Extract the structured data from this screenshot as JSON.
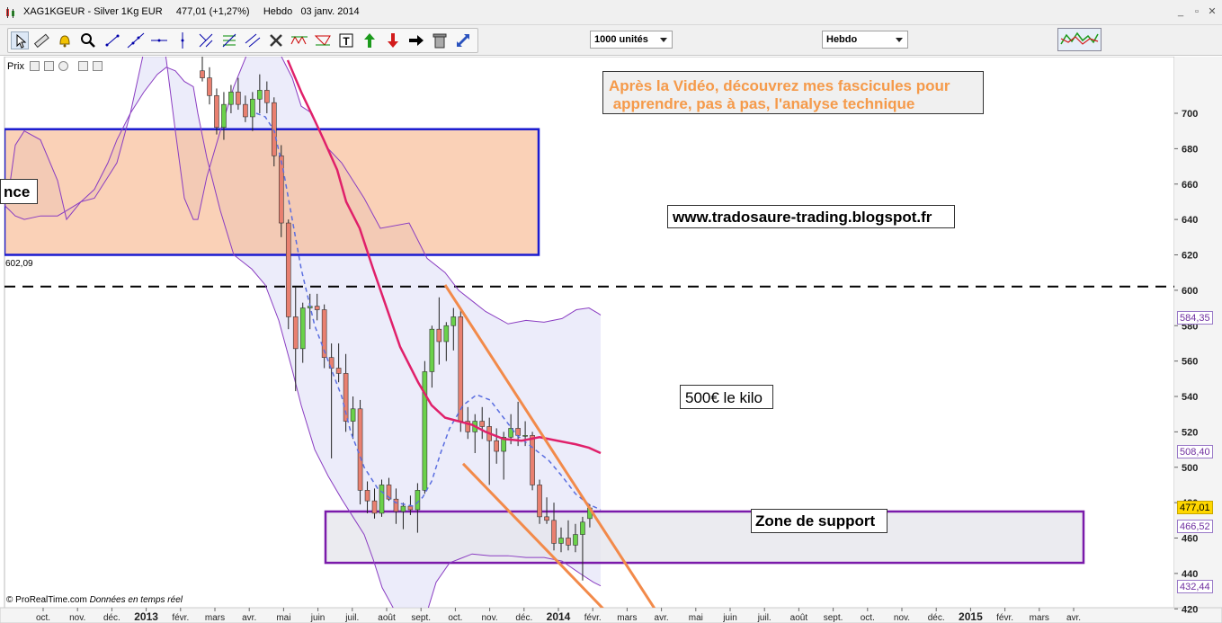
{
  "window": {
    "title": "XAG1KGEUR - Silver 1Kg EUR     477,01 (+1,27%)     Hebdo   03 janv. 2014",
    "minimize": "_",
    "restore": "▫",
    "close": "✕"
  },
  "toolbar": {
    "icons": [
      "cursor-icon",
      "ruler-icon",
      "alarm-icon",
      "zoom-icon",
      "segment-icon",
      "line-icon",
      "horizontal-line-icon",
      "vertical-line-icon",
      "crosshair-icon",
      "fibonacci-icon",
      "channel-icon",
      "tools-icon",
      "pattern-icon",
      "triangle-icon",
      "text-icon",
      "buy-arrow-icon",
      "sell-arrow-icon",
      "right-arrow-icon",
      "trash-icon",
      "expand-icon"
    ],
    "quantity": "1000 unités",
    "period": "Hebdo"
  },
  "chart_header": {
    "label": "Prix"
  },
  "notes": {
    "promo": "Après la Vidéo, découvrez mes fascicules pour\n apprendre, pas à pas, l'analyse technique",
    "blog": "www.tradosaure-trading.blogspot.fr",
    "kilo": "500€ le kilo",
    "support": "Zone de support",
    "resistance": "nce"
  },
  "reference_level": "602,09",
  "price_labels": [
    {
      "text": "584,35",
      "value": 584.35,
      "color": "#7030a0"
    },
    {
      "text": "508,40",
      "value": 508.4,
      "color": "#7030a0"
    },
    {
      "text": "477,01",
      "value": 477.01,
      "color": "#000000",
      "bg": "#ffd700"
    },
    {
      "text": "466,52",
      "value": 466.52,
      "color": "#7030a0"
    },
    {
      "text": "432,44",
      "value": 432.44,
      "color": "#7030a0"
    }
  ],
  "footer": {
    "brand": "© ProRealTime.com",
    "status": "Données en temps réel"
  },
  "chart_data": {
    "type": "candlestick",
    "timeframe": "Hebdo",
    "ylim": [
      412,
      732
    ],
    "y_ticks": [
      420,
      440,
      460,
      480,
      500,
      520,
      540,
      560,
      580,
      600,
      620,
      640,
      660,
      680,
      700
    ],
    "x_ticks": [
      "oct.",
      "nov.",
      "déc.",
      "2013",
      "févr.",
      "mars",
      "avr.",
      "mai",
      "juin",
      "juil.",
      "août",
      "sept.",
      "oct.",
      "nov.",
      "déc.",
      "2014",
      "févr.",
      "mars",
      "avr.",
      "mai",
      "juin",
      "juil.",
      "août",
      "sept.",
      "oct.",
      "nov.",
      "déc.",
      "2015",
      "févr.",
      "mars",
      "avr."
    ],
    "bold_ticks": [
      "2013",
      "2014",
      "2015"
    ],
    "candles": [
      {
        "o": 724,
        "h": 735,
        "l": 718,
        "c": 720
      },
      {
        "o": 720,
        "h": 726,
        "l": 705,
        "c": 710
      },
      {
        "o": 710,
        "h": 714,
        "l": 688,
        "c": 692
      },
      {
        "o": 692,
        "h": 712,
        "l": 685,
        "c": 705
      },
      {
        "o": 705,
        "h": 716,
        "l": 700,
        "c": 712
      },
      {
        "o": 712,
        "h": 720,
        "l": 702,
        "c": 705
      },
      {
        "o": 705,
        "h": 710,
        "l": 695,
        "c": 698
      },
      {
        "o": 698,
        "h": 712,
        "l": 690,
        "c": 708
      },
      {
        "o": 708,
        "h": 722,
        "l": 700,
        "c": 713
      },
      {
        "o": 713,
        "h": 718,
        "l": 700,
        "c": 706
      },
      {
        "o": 706,
        "h": 709,
        "l": 670,
        "c": 676
      },
      {
        "o": 676,
        "h": 682,
        "l": 630,
        "c": 638
      },
      {
        "o": 638,
        "h": 640,
        "l": 578,
        "c": 585
      },
      {
        "o": 585,
        "h": 602,
        "l": 543,
        "c": 567
      },
      {
        "o": 567,
        "h": 593,
        "l": 559,
        "c": 590
      },
      {
        "o": 590,
        "h": 598,
        "l": 578,
        "c": 591
      },
      {
        "o": 591,
        "h": 598,
        "l": 583,
        "c": 589
      },
      {
        "o": 589,
        "h": 592,
        "l": 556,
        "c": 562
      },
      {
        "o": 562,
        "h": 570,
        "l": 505,
        "c": 556
      },
      {
        "o": 556,
        "h": 570,
        "l": 548,
        "c": 553
      },
      {
        "o": 553,
        "h": 564,
        "l": 520,
        "c": 526
      },
      {
        "o": 526,
        "h": 540,
        "l": 516,
        "c": 533
      },
      {
        "o": 533,
        "h": 538,
        "l": 479,
        "c": 487
      },
      {
        "o": 487,
        "h": 492,
        "l": 474,
        "c": 481
      },
      {
        "o": 481,
        "h": 488,
        "l": 471,
        "c": 474
      },
      {
        "o": 474,
        "h": 493,
        "l": 472,
        "c": 490
      },
      {
        "o": 490,
        "h": 494,
        "l": 481,
        "c": 482
      },
      {
        "o": 482,
        "h": 488,
        "l": 468,
        "c": 475
      },
      {
        "o": 475,
        "h": 480,
        "l": 465,
        "c": 478
      },
      {
        "o": 478,
        "h": 484,
        "l": 473,
        "c": 476
      },
      {
        "o": 476,
        "h": 491,
        "l": 463,
        "c": 487
      },
      {
        "o": 487,
        "h": 560,
        "l": 485,
        "c": 554
      },
      {
        "o": 554,
        "h": 580,
        "l": 545,
        "c": 578
      },
      {
        "o": 578,
        "h": 596,
        "l": 558,
        "c": 571
      },
      {
        "o": 571,
        "h": 582,
        "l": 560,
        "c": 580
      },
      {
        "o": 580,
        "h": 590,
        "l": 566,
        "c": 585
      },
      {
        "o": 585,
        "h": 590,
        "l": 520,
        "c": 526
      },
      {
        "o": 526,
        "h": 534,
        "l": 516,
        "c": 520
      },
      {
        "o": 520,
        "h": 530,
        "l": 508,
        "c": 526
      },
      {
        "o": 526,
        "h": 534,
        "l": 516,
        "c": 523
      },
      {
        "o": 523,
        "h": 528,
        "l": 490,
        "c": 515
      },
      {
        "o": 515,
        "h": 522,
        "l": 502,
        "c": 509
      },
      {
        "o": 509,
        "h": 520,
        "l": 493,
        "c": 517
      },
      {
        "o": 517,
        "h": 530,
        "l": 513,
        "c": 522
      },
      {
        "o": 522,
        "h": 537,
        "l": 512,
        "c": 518
      },
      {
        "o": 518,
        "h": 526,
        "l": 512,
        "c": 518
      },
      {
        "o": 518,
        "h": 520,
        "l": 487,
        "c": 490
      },
      {
        "o": 490,
        "h": 493,
        "l": 468,
        "c": 472
      },
      {
        "o": 472,
        "h": 483,
        "l": 468,
        "c": 470
      },
      {
        "o": 470,
        "h": 480,
        "l": 453,
        "c": 457
      },
      {
        "o": 457,
        "h": 466,
        "l": 452,
        "c": 460
      },
      {
        "o": 460,
        "h": 470,
        "l": 453,
        "c": 456
      },
      {
        "o": 456,
        "h": 468,
        "l": 452,
        "c": 462
      },
      {
        "o": 462,
        "h": 472,
        "l": 436,
        "c": 469
      },
      {
        "o": 471,
        "h": 479,
        "l": 466,
        "c": 477
      }
    ],
    "reference_line": 602.09,
    "resistance_zone": [
      620,
      691
    ],
    "support_zone": [
      446,
      475
    ],
    "series": [
      {
        "kind": "bollinger-upper",
        "points": [
          [
            0,
            648
          ],
          [
            6,
            660
          ],
          [
            12,
            682
          ],
          [
            22,
            690
          ],
          [
            40,
            685
          ],
          [
            59,
            662
          ],
          [
            69,
            640
          ],
          [
            85,
            650
          ],
          [
            100,
            652
          ],
          [
            125,
            672
          ],
          [
            140,
            700
          ],
          [
            155,
            735
          ],
          [
            170,
            760
          ],
          [
            180,
            730
          ],
          [
            190,
            690
          ],
          [
            200,
            652
          ],
          [
            210,
            640
          ],
          [
            215,
            640
          ],
          [
            225,
            664
          ],
          [
            240,
            690
          ],
          [
            255,
            715
          ],
          [
            275,
            740
          ],
          [
            290,
            760
          ],
          [
            305,
            735
          ],
          [
            320,
            720
          ],
          [
            330,
            704
          ],
          [
            342,
            700
          ],
          [
            350,
            690
          ],
          [
            360,
            680
          ],
          [
            375,
            672
          ],
          [
            385,
            664
          ],
          [
            400,
            652
          ],
          [
            418,
            635
          ],
          [
            450,
            638
          ],
          [
            470,
            618
          ],
          [
            490,
            610
          ],
          [
            505,
            600
          ],
          [
            520,
            594
          ],
          [
            535,
            588
          ],
          [
            560,
            581
          ],
          [
            580,
            583
          ],
          [
            600,
            582
          ],
          [
            620,
            584
          ],
          [
            636,
            589
          ],
          [
            650,
            590
          ],
          [
            660,
            587
          ],
          [
            663,
            586
          ]
        ]
      },
      {
        "kind": "bollinger-lower",
        "points": [
          [
            0,
            648
          ],
          [
            6,
            645
          ],
          [
            12,
            642
          ],
          [
            22,
            640
          ],
          [
            40,
            642
          ],
          [
            59,
            642
          ],
          [
            69,
            645
          ],
          [
            85,
            650
          ],
          [
            100,
            657
          ],
          [
            115,
            672
          ],
          [
            125,
            685
          ],
          [
            140,
            700
          ],
          [
            155,
            712
          ],
          [
            170,
            722
          ],
          [
            180,
            726
          ],
          [
            190,
            724
          ],
          [
            200,
            718
          ],
          [
            210,
            715
          ],
          [
            215,
            700
          ],
          [
            225,
            675
          ],
          [
            240,
            645
          ],
          [
            255,
            620
          ],
          [
            275,
            612
          ],
          [
            290,
            603
          ],
          [
            305,
            583
          ],
          [
            320,
            555
          ],
          [
            330,
            535
          ],
          [
            345,
            510
          ],
          [
            360,
            495
          ],
          [
            375,
            482
          ],
          [
            385,
            474
          ],
          [
            400,
            462
          ],
          [
            410,
            448
          ],
          [
            420,
            432
          ],
          [
            435,
            418
          ],
          [
            450,
            409
          ],
          [
            465,
            410
          ],
          [
            480,
            435
          ],
          [
            495,
            446
          ],
          [
            505,
            448
          ],
          [
            520,
            451
          ],
          [
            540,
            450
          ],
          [
            560,
            450
          ],
          [
            580,
            449
          ],
          [
            600,
            449
          ],
          [
            620,
            447
          ],
          [
            640,
            440
          ],
          [
            655,
            435
          ],
          [
            663,
            433
          ]
        ]
      },
      {
        "kind": "moving-average-fast",
        "points": [
          [
            280,
            700
          ],
          [
            290,
            698
          ],
          [
            300,
            690
          ],
          [
            310,
            668
          ],
          [
            320,
            640
          ],
          [
            330,
            612
          ],
          [
            345,
            580
          ],
          [
            360,
            560
          ],
          [
            375,
            540
          ],
          [
            385,
            520
          ],
          [
            400,
            500
          ],
          [
            415,
            488
          ],
          [
            435,
            480
          ],
          [
            455,
            478
          ],
          [
            465,
            483
          ],
          [
            475,
            492
          ],
          [
            485,
            508
          ],
          [
            495,
            522
          ],
          [
            510,
            535
          ],
          [
            525,
            541
          ],
          [
            540,
            538
          ],
          [
            555,
            528
          ],
          [
            570,
            518
          ],
          [
            590,
            510
          ],
          [
            605,
            504
          ],
          [
            620,
            495
          ],
          [
            635,
            485
          ],
          [
            650,
            479
          ],
          [
            663,
            476
          ]
        ]
      },
      {
        "kind": "moving-average-slow",
        "points": [
          [
            315,
            730
          ],
          [
            330,
            712
          ],
          [
            345,
            696
          ],
          [
            355,
            685
          ],
          [
            370,
            668
          ],
          [
            380,
            650
          ],
          [
            395,
            635
          ],
          [
            410,
            612
          ],
          [
            425,
            590
          ],
          [
            440,
            568
          ],
          [
            460,
            548
          ],
          [
            475,
            535
          ],
          [
            490,
            528
          ],
          [
            505,
            526
          ],
          [
            520,
            524
          ],
          [
            535,
            520
          ],
          [
            555,
            516
          ],
          [
            575,
            515
          ],
          [
            595,
            517
          ],
          [
            615,
            515
          ],
          [
            635,
            513
          ],
          [
            650,
            511
          ],
          [
            663,
            508
          ]
        ]
      }
    ],
    "trendlines": [
      {
        "color": "#f28a4a",
        "from": [
          495,
          603
        ],
        "to": [
          732,
          417
        ]
      },
      {
        "color": "#f28a4a",
        "from": [
          515,
          502
        ],
        "to": [
          690,
          410
        ]
      }
    ]
  }
}
